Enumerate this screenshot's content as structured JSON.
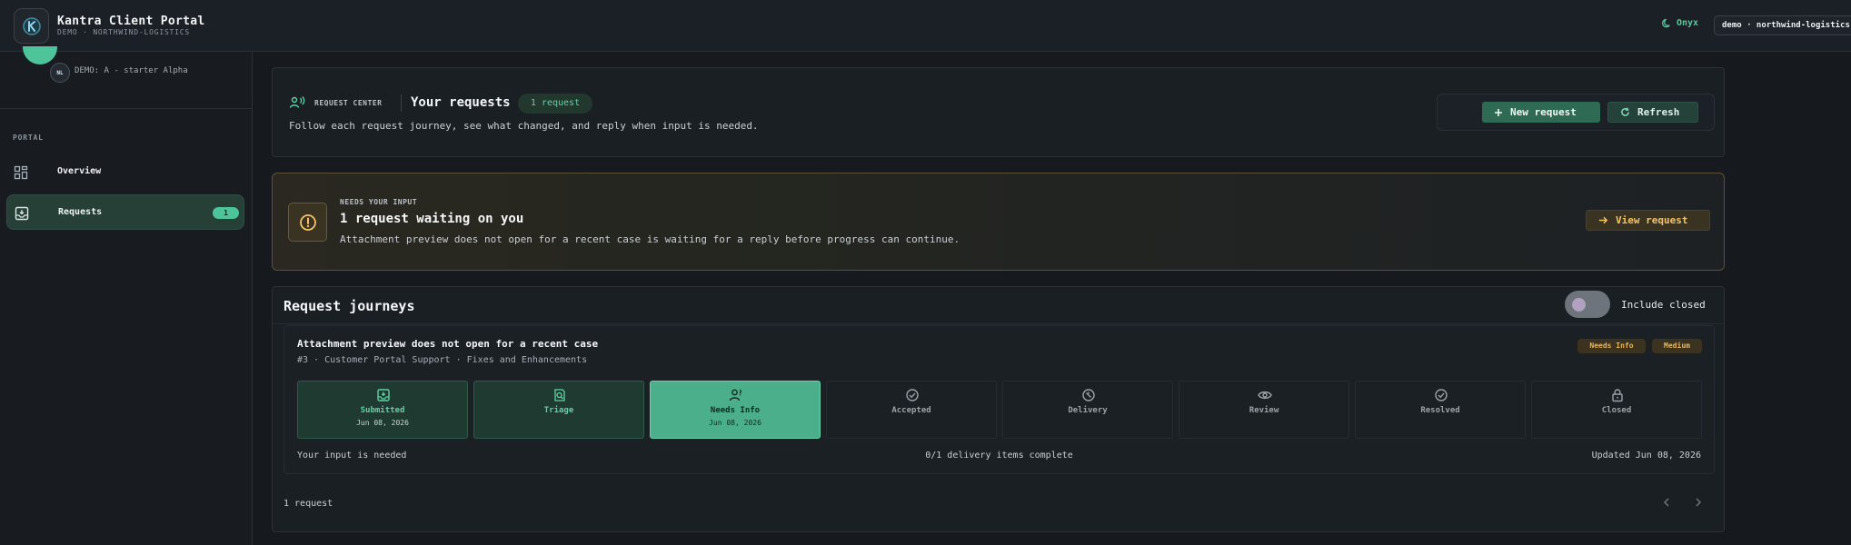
{
  "header": {
    "title": "Kantra Client Portal",
    "subtitle": "DEMO · NORTHWIND-LOGISTICS",
    "theme_label": "Onyx",
    "tenant": "demo · northwind-logistics"
  },
  "sidebar": {
    "avatar_initials": "NL",
    "org_name": "DEMO: A - starter Alpha",
    "section_label": "PORTAL",
    "items": [
      {
        "label": "Overview"
      },
      {
        "label": "Requests",
        "badge": "1"
      }
    ]
  },
  "request_center": {
    "eyebrow": "REQUEST CENTER",
    "title": "Your requests",
    "count": "1 request",
    "description": "Follow each request journey, see what changed, and reply when input is needed.",
    "new_button": "New request",
    "refresh_button": "Refresh"
  },
  "needs_input": {
    "eyebrow": "NEEDS YOUR INPUT",
    "title": "1 request waiting on you",
    "description": "Attachment preview does not open for a recent case is waiting for a reply before progress can continue.",
    "view_button": "View request"
  },
  "journeys": {
    "title": "Request journeys",
    "toggle_label": "Include closed",
    "toggle_on": false,
    "request": {
      "title": "Attachment preview does not open for a recent case",
      "meta": "#3 · Customer Portal Support · Fixes and Enhancements",
      "status_tag": "Needs Info",
      "priority_tag": "Medium",
      "steps": [
        {
          "name": "Submitted",
          "date": "Jun 08, 2026",
          "state": "done",
          "icon": "inbox-icon"
        },
        {
          "name": "Triage",
          "date": "",
          "state": "done",
          "icon": "search-doc-icon"
        },
        {
          "name": "Needs Info",
          "date": "Jun 08, 2026",
          "state": "current",
          "icon": "user-question-icon"
        },
        {
          "name": "Accepted",
          "date": "",
          "state": "pending",
          "icon": "check-circle-icon"
        },
        {
          "name": "Delivery",
          "date": "",
          "state": "pending",
          "icon": "delivery-icon"
        },
        {
          "name": "Review",
          "date": "",
          "state": "pending",
          "icon": "eye-icon"
        },
        {
          "name": "Resolved",
          "date": "",
          "state": "pending",
          "icon": "check-circle-icon"
        },
        {
          "name": "Closed",
          "date": "",
          "state": "pending",
          "icon": "lock-icon"
        }
      ],
      "footer_left": "Your input is needed",
      "footer_mid": "0/1 delivery items complete",
      "footer_right": "Updated Jun 08, 2026"
    },
    "count_label": "1 request"
  },
  "colors": {
    "accent": "#4ec49a",
    "warning": "#e8b659",
    "background": "#161a1f"
  }
}
